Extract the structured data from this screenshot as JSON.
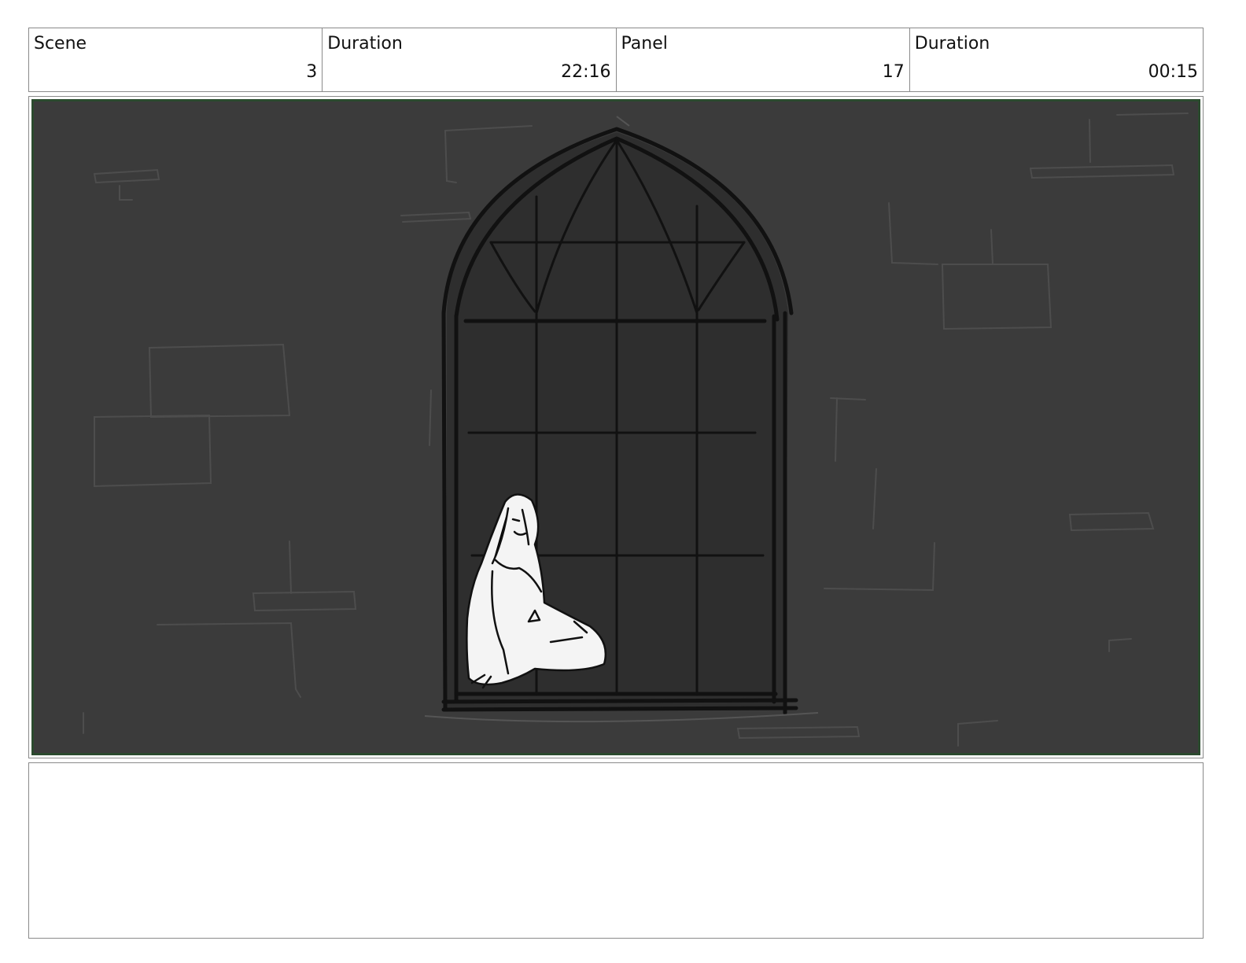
{
  "header": {
    "scene": {
      "label": "Scene",
      "value": "3"
    },
    "scene_duration": {
      "label": "Duration",
      "value": "22:16"
    },
    "panel": {
      "label": "Panel",
      "value": "17"
    },
    "panel_duration": {
      "label": "Duration",
      "value": "00:15"
    }
  },
  "panel_art": {
    "background_color": "#3b3b3b",
    "frame_color": "#2b4a2e"
  },
  "notes": {
    "text": ""
  }
}
